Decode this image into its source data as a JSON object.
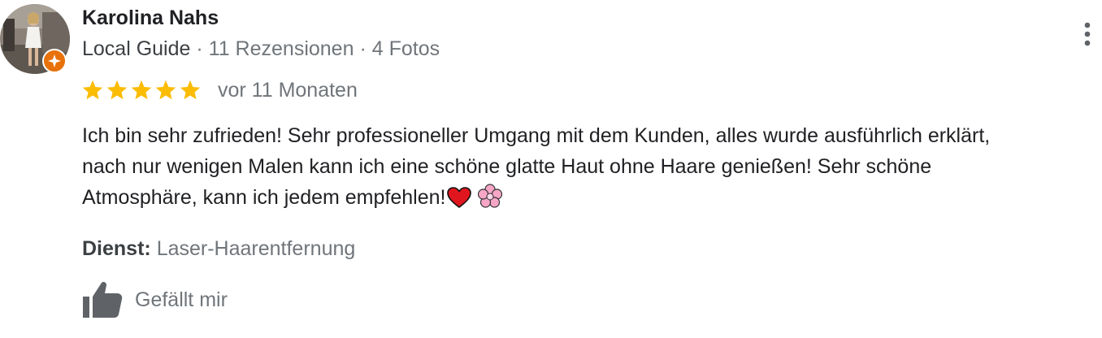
{
  "review": {
    "reviewer": {
      "name": "Karolina Nahs",
      "guide_label": "Local Guide",
      "separator_1": " · ",
      "review_count": "11 Rezensionen",
      "separator_2": " · ",
      "photo_count": "4 Fotos"
    },
    "rating": {
      "value": 5,
      "max": 5,
      "star_color": "#fbbc04"
    },
    "date": "vor 11 Monaten",
    "text_lines": [
      "Ich bin sehr zufrieden! Sehr professioneller Umgang mit dem Kunden, alles wurde ausführlich erklärt,",
      "nach nur wenigen Malen kann ich eine schöne glatte Haut ohne Haare genießen! Sehr schöne",
      "Atmosphäre, kann ich jedem empfehlen!"
    ],
    "emojis": [
      "heart-emoji",
      "cherry-blossom-emoji"
    ],
    "service": {
      "label": "Dienst:",
      "value": "Laser-Haarentfernung"
    },
    "like": {
      "label": "Gefällt mir",
      "icon": "thumbs-up-icon"
    },
    "menu_icon": "more-vert-icon",
    "colors": {
      "badge": "#e8710a",
      "primary_text": "#202124",
      "secondary_text": "#70757a"
    }
  }
}
